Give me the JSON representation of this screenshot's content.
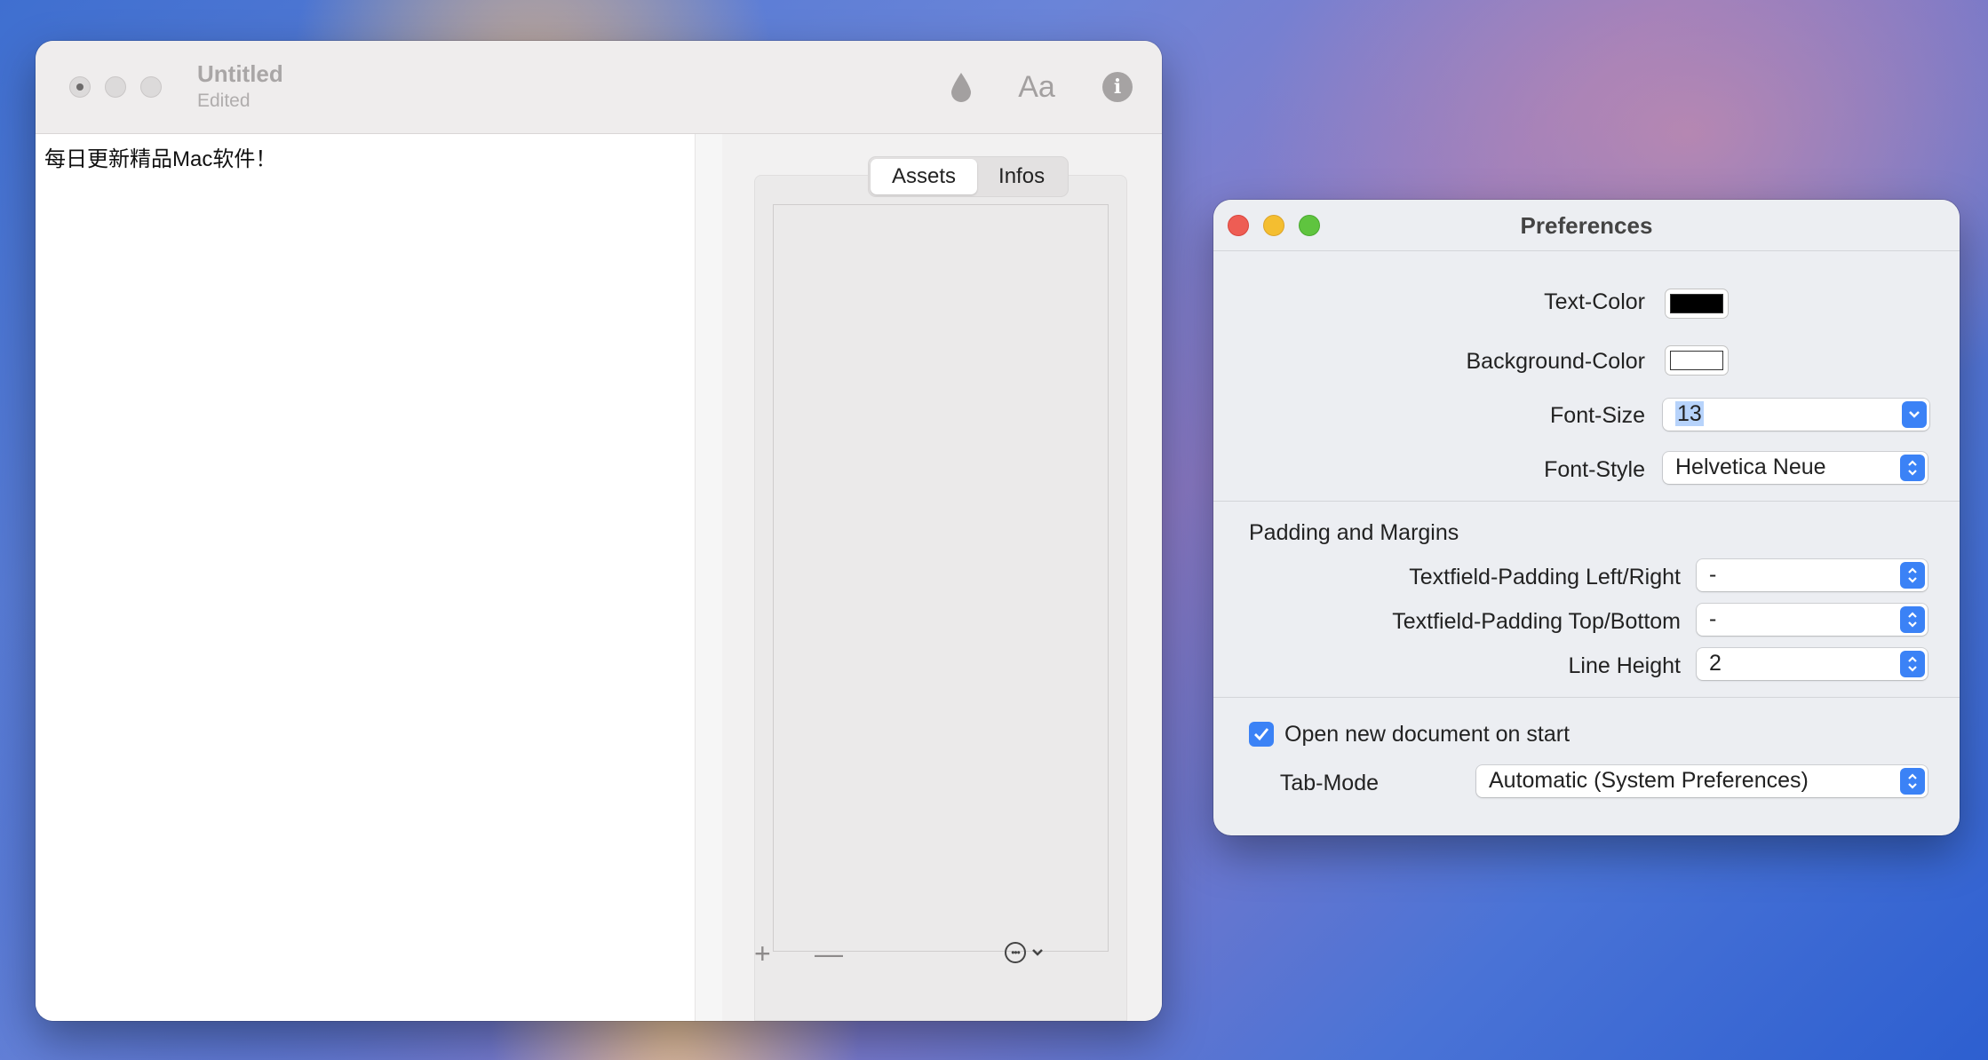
{
  "editor": {
    "title": "Untitled",
    "subtitle": "Edited",
    "toolbar": {
      "font_label": "Aa",
      "info_label": "i"
    },
    "text_content": "每日更新精品Mac软件！",
    "sidebar": {
      "tabs": [
        {
          "label": "Assets",
          "active": true
        },
        {
          "label": "Infos",
          "active": false
        }
      ],
      "add_label": "+",
      "remove_label": "—"
    }
  },
  "preferences": {
    "title": "Preferences",
    "text_color": {
      "label": "Text-Color",
      "value": "#000000"
    },
    "background_color": {
      "label": "Background-Color",
      "value": "#ffffff"
    },
    "font_size": {
      "label": "Font-Size",
      "value": "13"
    },
    "font_style": {
      "label": "Font-Style",
      "value": "Helvetica Neue"
    },
    "padding_section": {
      "title": "Padding and Margins",
      "padding_lr": {
        "label": "Textfield-Padding Left/Right",
        "value": "-"
      },
      "padding_tb": {
        "label": "Textfield-Padding Top/Bottom",
        "value": "-"
      },
      "line_height": {
        "label": "Line Height",
        "value": "2"
      }
    },
    "open_new_document": {
      "label": "Open new document on start",
      "checked": true
    },
    "tab_mode": {
      "label": "Tab-Mode",
      "value": "Automatic (System Preferences)"
    }
  },
  "colors": {
    "accent": "#3b82f6",
    "close": "#ee5d54",
    "minimize": "#f4be30",
    "zoom": "#5fc43f"
  }
}
